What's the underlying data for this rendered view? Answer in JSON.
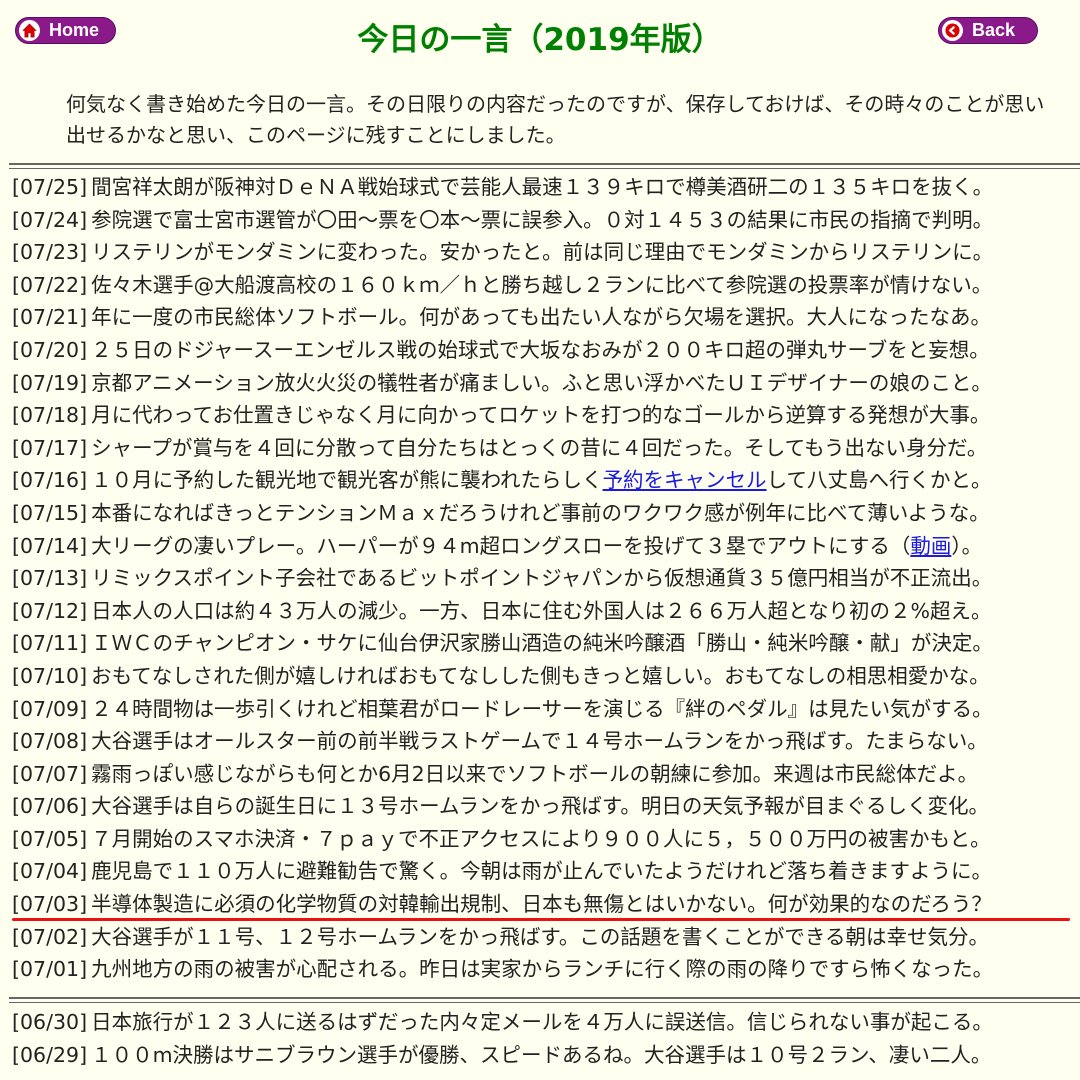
{
  "nav": {
    "home_label": "Home",
    "back_label": "Back"
  },
  "page": {
    "title": "今日の一言（2019年版）",
    "intro": "何気なく書き始めた今日の一言。その日限りの内容だったのですが、保存しておけば、その時々のことが思い出せるかなと思い、このページに残すことにしました。"
  },
  "july": [
    {
      "date": "[07/25]",
      "text": "間宮祥太朗が阪神対ＤｅＮＡ戦始球式で芸能人最速１３９キロで樽美酒研二の１３５キロを抜く。"
    },
    {
      "date": "[07/24]",
      "text": "参院選で富士宮市選管が〇田～票を〇本～票に誤参入。０対１４５３の結果に市民の指摘で判明。"
    },
    {
      "date": "[07/23]",
      "text": "リステリンがモンダミンに変わった。安かったと。前は同じ理由でモンダミンからリステリンに。"
    },
    {
      "date": "[07/22]",
      "text": "佐々木選手@大船渡高校の１６０ｋｍ／ｈと勝ち越し２ランに比べて参院選の投票率が情けない。"
    },
    {
      "date": "[07/21]",
      "text": "年に一度の市民総体ソフトボール。何があっても出たい人ながら欠場を選択。大人になったなあ。"
    },
    {
      "date": "[07/20]",
      "text": "２５日のドジャースーエンゼルス戦の始球式で大坂なおみが２００キロ超の弾丸サーブをと妄想。"
    },
    {
      "date": "[07/19]",
      "text": "京都アニメーション放火火災の犠牲者が痛ましい。ふと思い浮かべたＵＩデザイナーの娘のこと。"
    },
    {
      "date": "[07/18]",
      "text": "月に代わってお仕置きじゃなく月に向かってロケットを打つ的なゴールから逆算する発想が大事。"
    },
    {
      "date": "[07/17]",
      "text": "シャープが賞与を４回に分散って自分たちはとっくの昔に４回だった。そしてもう出ない身分だ。"
    },
    {
      "date": "[07/16]",
      "text_before": "１０月に予約した観光地で観光客が熊に襲われたらしく",
      "link": "予約をキャンセル",
      "text_after": "して八丈島へ行くかと。"
    },
    {
      "date": "[07/15]",
      "text": "本番になればきっとテンションＭａｘだろうけれど事前のワクワク感が例年に比べて薄いような。"
    },
    {
      "date": "[07/14]",
      "text_before": "大リーグの凄いプレー。ハーパーが９４m超ロングスローを投げて３塁でアウトにする（",
      "link": "動画",
      "text_after": "）。"
    },
    {
      "date": "[07/13]",
      "text": "リミックスポイント子会社であるビットポイントジャパンから仮想通貨３５億円相当が不正流出。"
    },
    {
      "date": "[07/12]",
      "text": "日本人の人口は約４３万人の減少。一方、日本に住む外国人は２６６万人超となり初の２%超え。"
    },
    {
      "date": "[07/11]",
      "text": "ＩＷＣのチャンピオン・サケに仙台伊沢家勝山酒造の純米吟醸酒「勝山・純米吟醸・献」が決定。"
    },
    {
      "date": "[07/10]",
      "text": "おもてなしされた側が嬉しければおもてなしした側もきっと嬉しい。おもてなしの相思相愛かな。"
    },
    {
      "date": "[07/09]",
      "text": "２４時間物は一歩引くけれど相葉君がロードレーサーを演じる『絆のペダル』は見たい気がする。"
    },
    {
      "date": "[07/08]",
      "text": "大谷選手はオールスター前の前半戦ラストゲームで１４号ホームランをかっ飛ばす。たまらない。"
    },
    {
      "date": "[07/07]",
      "text": "霧雨っぽい感じながらも何とか6月2日以来でソフトボールの朝練に参加。来週は市民総体だよ。"
    },
    {
      "date": "[07/06]",
      "text": "大谷選手は自らの誕生日に１３号ホームランをかっ飛ばす。明日の天気予報が目まぐるしく変化。"
    },
    {
      "date": "[07/05]",
      "text": "７月開始のスマホ決済・７ｐａｙで不正アクセスにより９００人に５，５００万円の被害かもと。"
    },
    {
      "date": "[07/04]",
      "text": "鹿児島で１１０万人に避難勧告で驚く。今朝は雨が止んでいたようだけれど落ち着きますように。"
    },
    {
      "date": "[07/03]",
      "text": "半導体製造に必須の化学物質の対韓輸出規制、日本も無傷とはいかない。何が効果的なのだろう？",
      "highlight": true
    },
    {
      "date": "[07/02]",
      "text": "大谷選手が１１号、１２号ホームランをかっ飛ばす。この話題を書くことができる朝は幸せ気分。"
    },
    {
      "date": "[07/01]",
      "text": "九州地方の雨の被害が心配される。昨日は実家からランチに行く際の雨の降りですら怖くなった。"
    }
  ],
  "june": [
    {
      "date": "[06/30]",
      "text": "日本旅行が１２３人に送るはずだった内々定メールを４万人に誤送信。信じられない事が起こる。"
    },
    {
      "date": "[06/29]",
      "text": "１００m決勝はサニブラウン選手が優勝、スピードあるね。大谷選手は１０号２ラン、凄い二人。"
    }
  ]
}
